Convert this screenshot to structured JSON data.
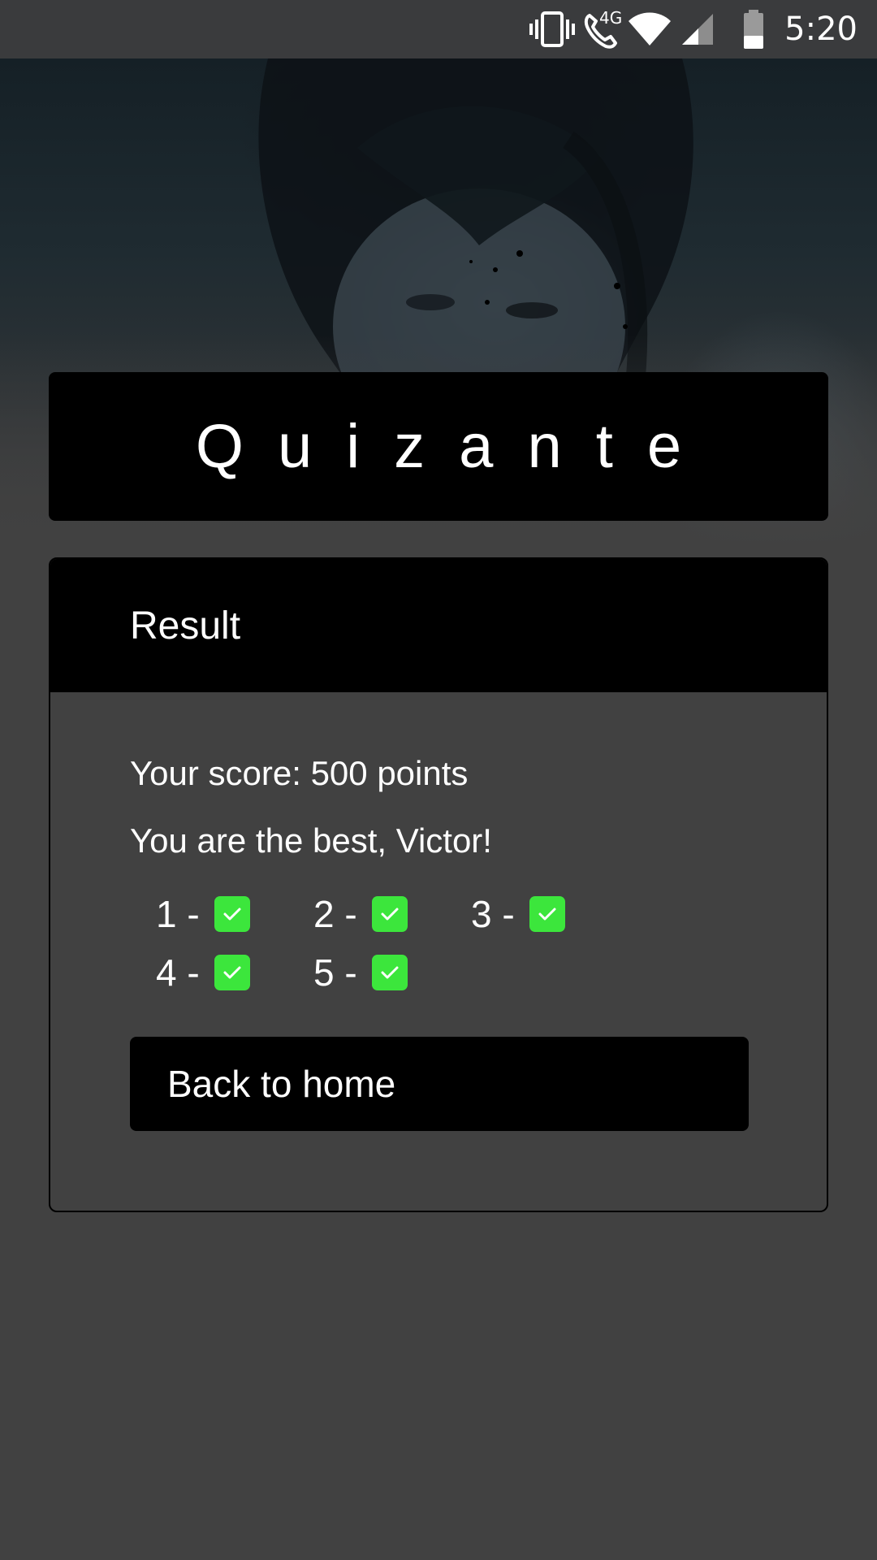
{
  "status_bar": {
    "time": "5:20",
    "network_label": "4G",
    "icons": [
      "vibrate-icon",
      "wifi-calling-icon",
      "wifi-icon",
      "signal-icon",
      "battery-icon"
    ]
  },
  "hero": {
    "image": "character-portrait-background"
  },
  "app": {
    "title": "Quizante"
  },
  "result": {
    "header": "Result",
    "score_text": "Your score: 500 points",
    "message": "You are the best, Victor!",
    "answers": [
      {
        "label": "1 -",
        "correct": true
      },
      {
        "label": "2 -",
        "correct": true
      },
      {
        "label": "3 -",
        "correct": true
      },
      {
        "label": "4 -",
        "correct": true
      },
      {
        "label": "5 -",
        "correct": true
      }
    ],
    "back_button": "Back to home"
  },
  "colors": {
    "background": "#414141",
    "card": "#000000",
    "check": "#3ce63c",
    "status_bar": "#3a3b3d"
  }
}
